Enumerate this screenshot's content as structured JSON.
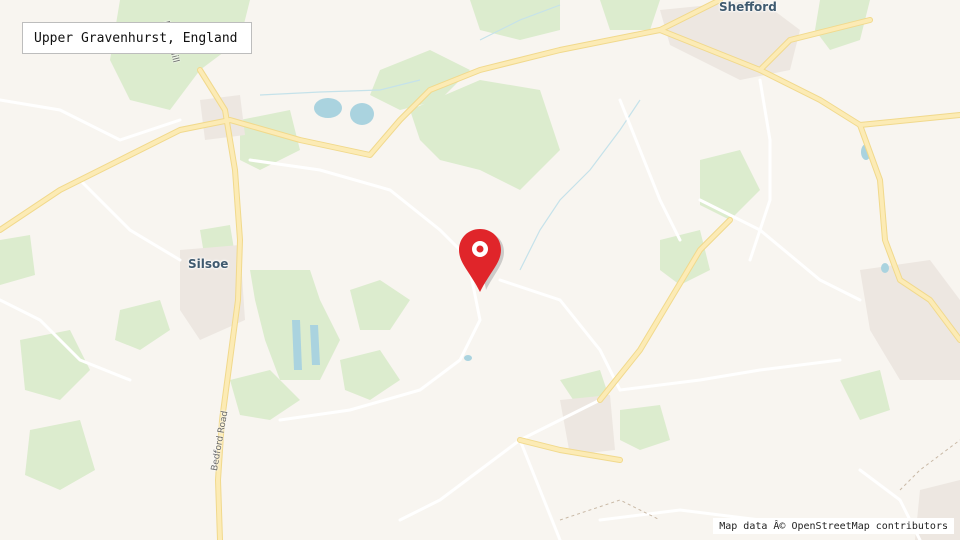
{
  "map": {
    "location_title": "Upper Gravenhurst, England",
    "attribution": "Map data Â© OpenStreetMap contributors",
    "places": {
      "shefford": "Shefford",
      "silsoe": "Silsoe"
    },
    "roads": {
      "bedford_road": "Bedford Road",
      "hill_road": "D... 's Hill"
    },
    "marker_icon": "map-pin-icon",
    "colors": {
      "land": "#f8f5f0",
      "woodland": "#dcecce",
      "major_road": "#fbe2a0",
      "water": "#aad3df",
      "marker": "#e0252a",
      "label": "#3f5a6f"
    }
  }
}
